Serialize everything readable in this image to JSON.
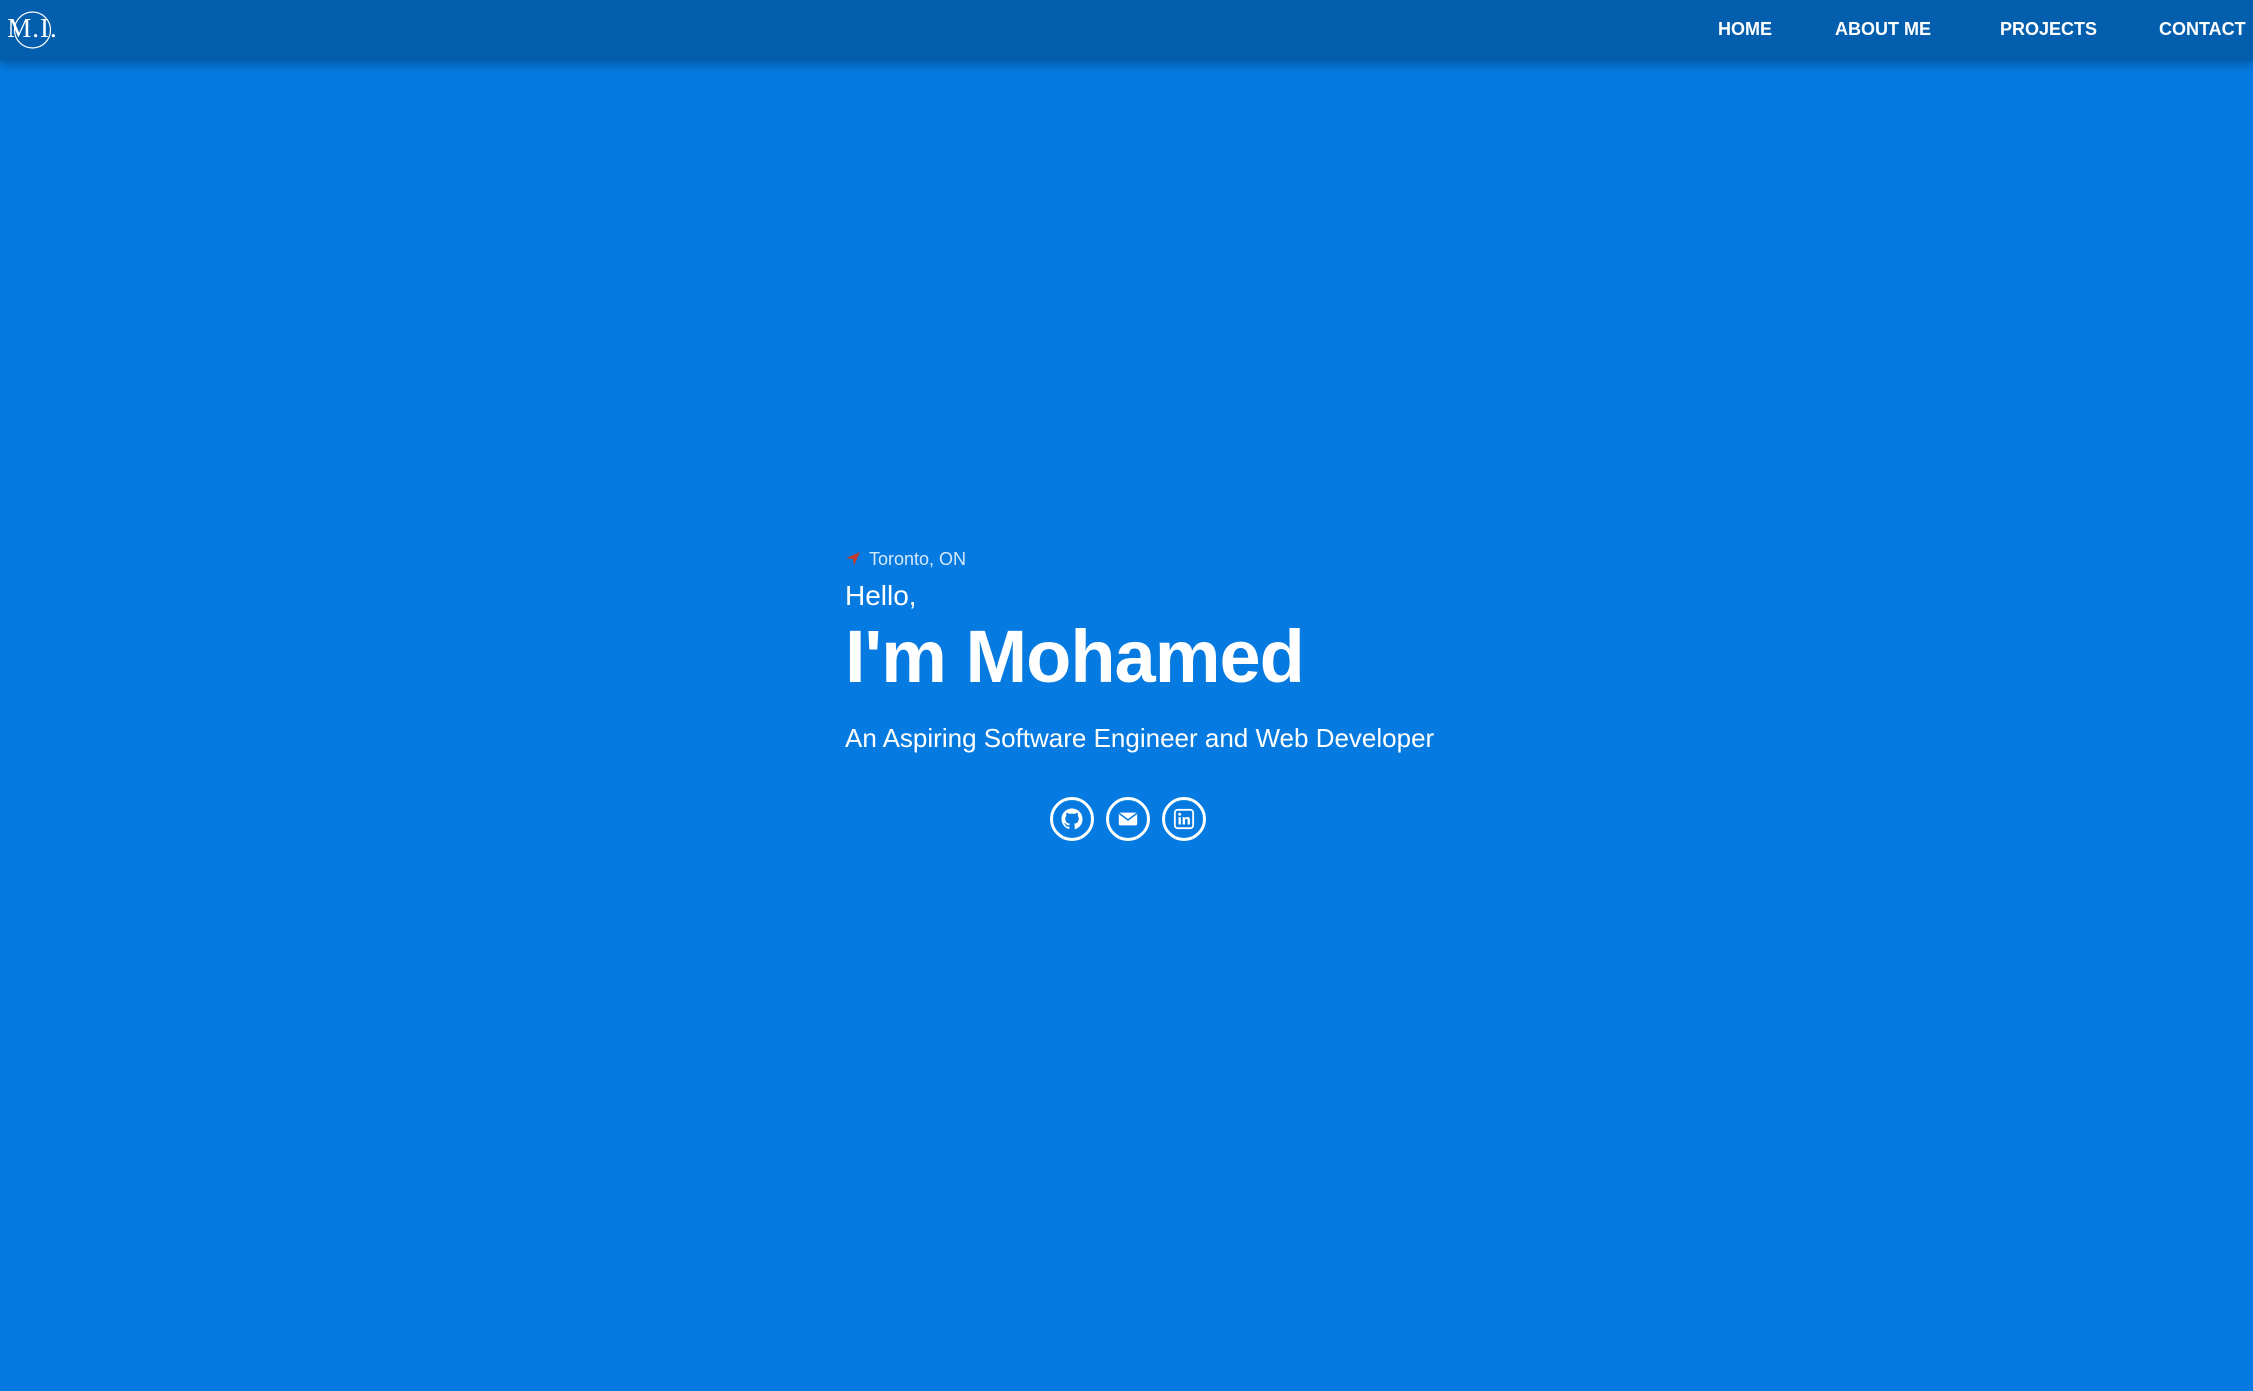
{
  "brand": {
    "logo_text": "M.I."
  },
  "nav": {
    "items": [
      {
        "label": "HOME"
      },
      {
        "label": "ABOUT ME"
      },
      {
        "label": "PROJECTS"
      },
      {
        "label": "CONTACT"
      }
    ]
  },
  "hero": {
    "location": "Toronto, ON",
    "greeting": "Hello,",
    "name": "I'm Mohamed",
    "tagline": "An Aspiring Software Engineer and Web Developer"
  },
  "socials": [
    {
      "icon": "github-icon"
    },
    {
      "icon": "envelope-icon"
    },
    {
      "icon": "linkedin-icon"
    }
  ],
  "colors": {
    "background": "#057ae0",
    "navbar": "#035fae",
    "location_icon": "#c0392b",
    "text": "#ffffff"
  }
}
